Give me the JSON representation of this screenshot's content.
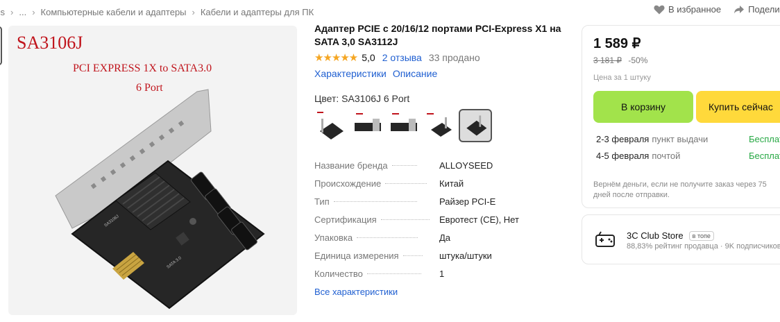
{
  "breadcrumbs": [
    "ss",
    "...",
    "Компьютерные кабели и адаптеры",
    "Кабели и адаптеры для ПК"
  ],
  "top_actions": {
    "favorites": "В избранное",
    "share": "Подели"
  },
  "photo": {
    "model": "SA3106J",
    "caption_line1": "PCI EXPRESS 1X to SATA3.0",
    "caption_line2": "6 Port"
  },
  "product": {
    "title": "Адаптер PCIE с 20/16/12 портами PCI-Express X1 на SATA 3,0 SA3112J",
    "stars": "★★★★★",
    "rating": "5,0",
    "reviews": "2 отзыва",
    "sold": "33 продано",
    "tabs": [
      "Характеристики",
      "Описание"
    ],
    "color_label": "Цвет:",
    "color_value": "SA3106J 6 Port",
    "variant_count": 5,
    "selected_variant": 5
  },
  "specs": [
    {
      "key": "Название бренда",
      "value": "ALLOYSEED"
    },
    {
      "key": "Происхождение",
      "value": "Китай"
    },
    {
      "key": "Тип",
      "value": "Райзер PCI-E"
    },
    {
      "key": "Сертификация",
      "value": "Евротест (CE), Нет"
    },
    {
      "key": "Упаковка",
      "value": "Да"
    },
    {
      "key": "Единица измерения",
      "value": "штука/штуки"
    },
    {
      "key": "Количество",
      "value": "1"
    }
  ],
  "all_specs_label": "Все характеристики",
  "buy": {
    "price": "1 589 ₽",
    "old_price": "3 181 ₽",
    "discount": "-50%",
    "per_unit": "Цена за 1 штуку",
    "cart_label": "В корзину",
    "buy_label": "Купить сейчас",
    "delivery": [
      {
        "date": "2-3 февраля",
        "kind": "пункт выдачи",
        "cost": "Бесплатно"
      },
      {
        "date": "4-5 февраля",
        "kind": "почтой",
        "cost": "Бесплатно"
      }
    ],
    "guarantee": "Вернём деньги, если не получите заказ через 75 дней после отправки."
  },
  "store": {
    "name": "3C Club Store",
    "badge": "в топе",
    "rating": "88,83% рейтинг продавца",
    "subscribers": "9K подписчиков"
  },
  "colors": {
    "link": "#1f5fd1",
    "cart": "#a2e34b",
    "buy": "#ffd93b",
    "free": "#27a844",
    "stars": "#f5a623",
    "model_red": "#c0141c"
  }
}
